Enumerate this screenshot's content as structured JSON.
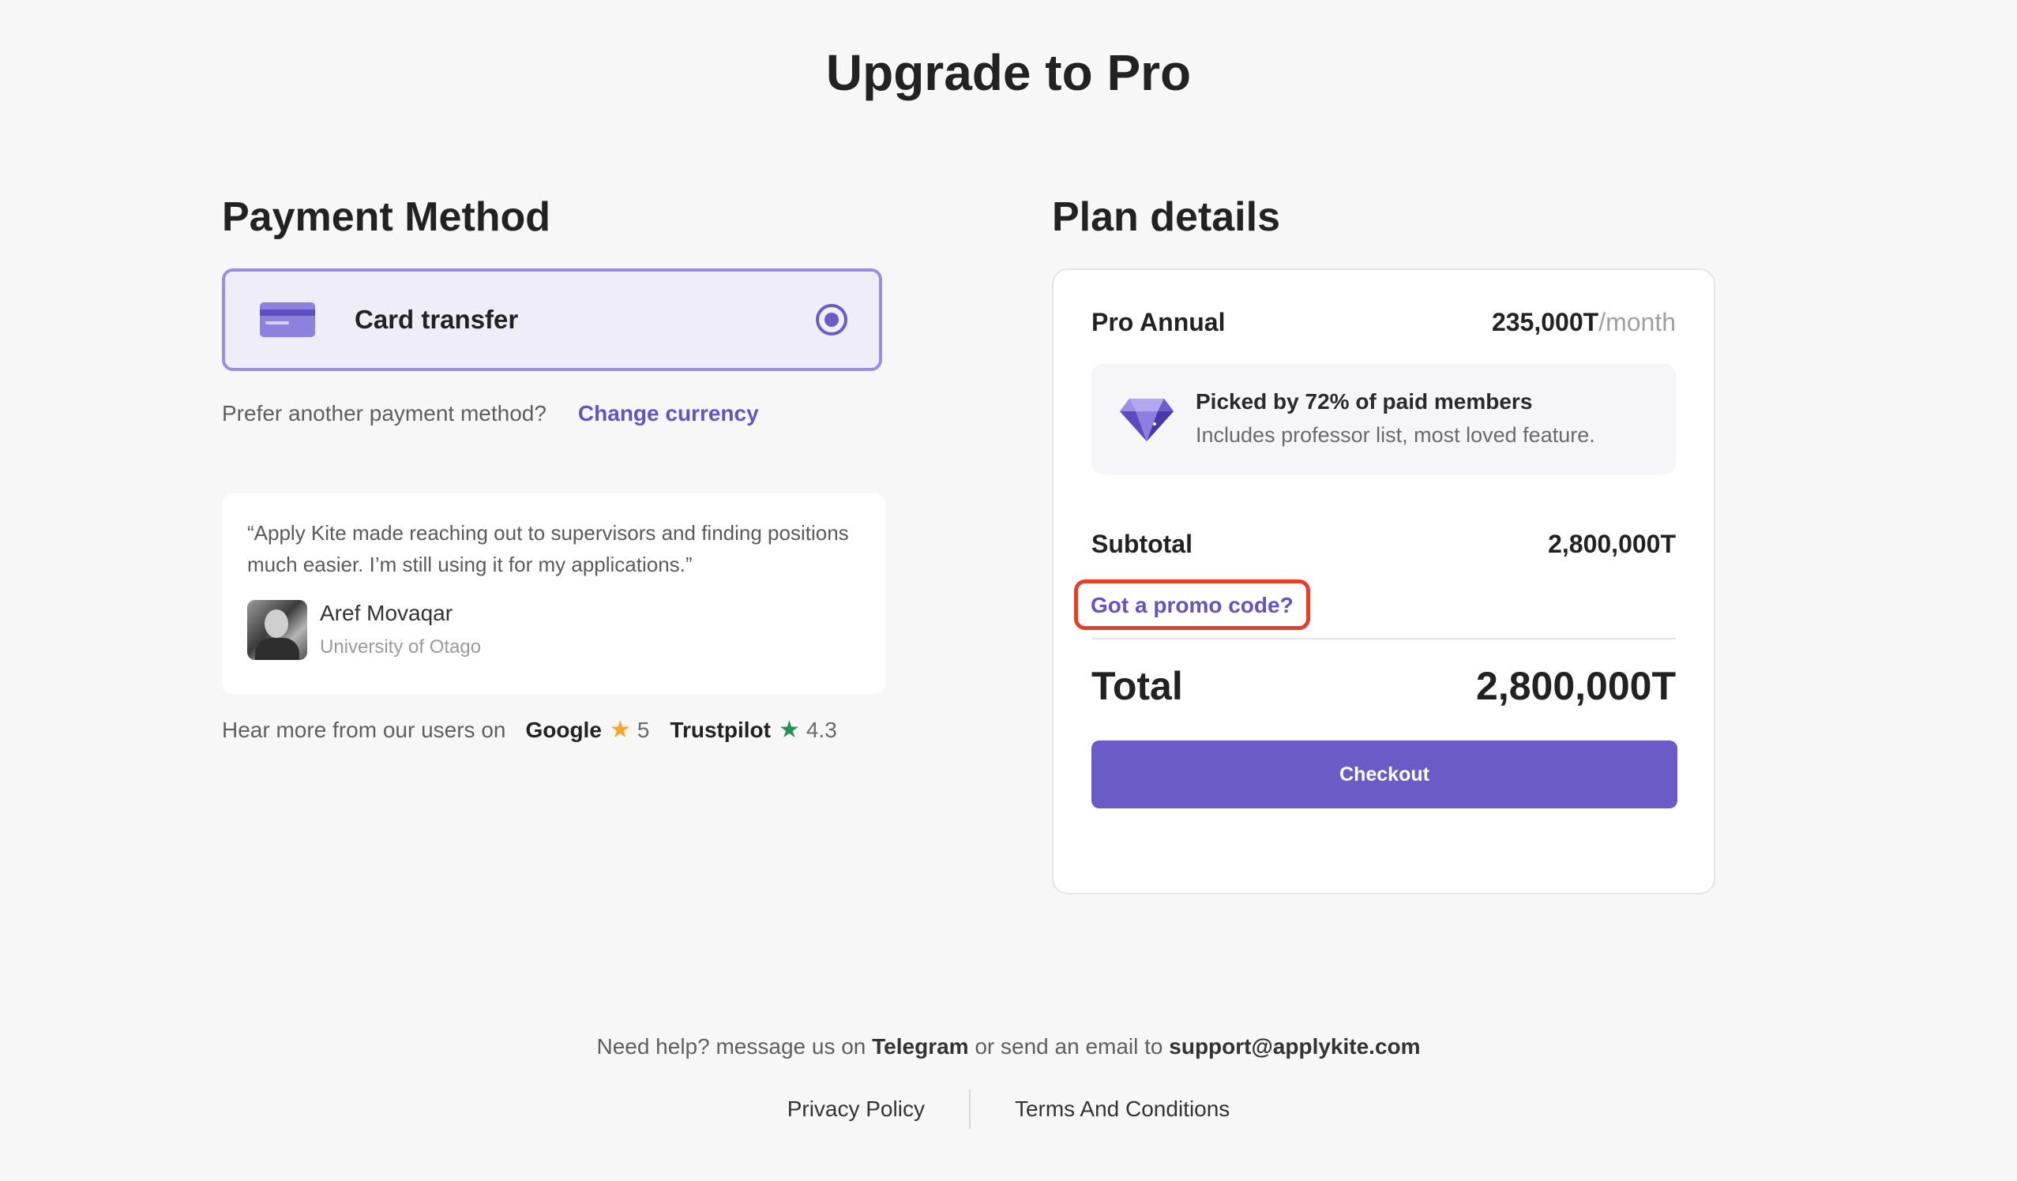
{
  "page": {
    "title": "Upgrade to Pro"
  },
  "payment": {
    "heading": "Payment Method",
    "method_label": "Card transfer",
    "method_icon": "credit-card-icon",
    "prefer_text": "Prefer another payment method?",
    "change_currency": "Change currency"
  },
  "testimonial": {
    "quote": "“Apply Kite made reaching out to supervisors and finding positions much easier. I’m still using it for my applications.”",
    "author_name": "Aref Movaqar",
    "author_school": "University of Otago"
  },
  "reviews": {
    "lead_text": "Hear more from our users on",
    "google_label": "Google",
    "google_score": "5",
    "trustpilot_label": "Trustpilot",
    "trustpilot_score": "4.3",
    "google_star_color": "#f4a52c",
    "trustpilot_star_color": "#2f8f56"
  },
  "plan": {
    "heading": "Plan details",
    "name": "Pro Annual",
    "price": "235,000T",
    "price_period": "/month",
    "highlight_title": "Picked by 72% of paid members",
    "highlight_sub": "Includes professor list, most loved feature.",
    "subtotal_label": "Subtotal",
    "subtotal_value": "2,800,000T",
    "promo_link": "Got a promo code?",
    "total_label": "Total",
    "total_value": "2,800,000T",
    "checkout_label": "Checkout"
  },
  "footer": {
    "help_prefix": "Need help? message us on ",
    "telegram": "Telegram",
    "help_middle": " or send an email to ",
    "email": "support@applykite.com",
    "privacy": "Privacy Policy",
    "terms": "Terms And Conditions"
  },
  "colors": {
    "accent": "#6a5bc6",
    "promo_outline": "#e2402c"
  }
}
